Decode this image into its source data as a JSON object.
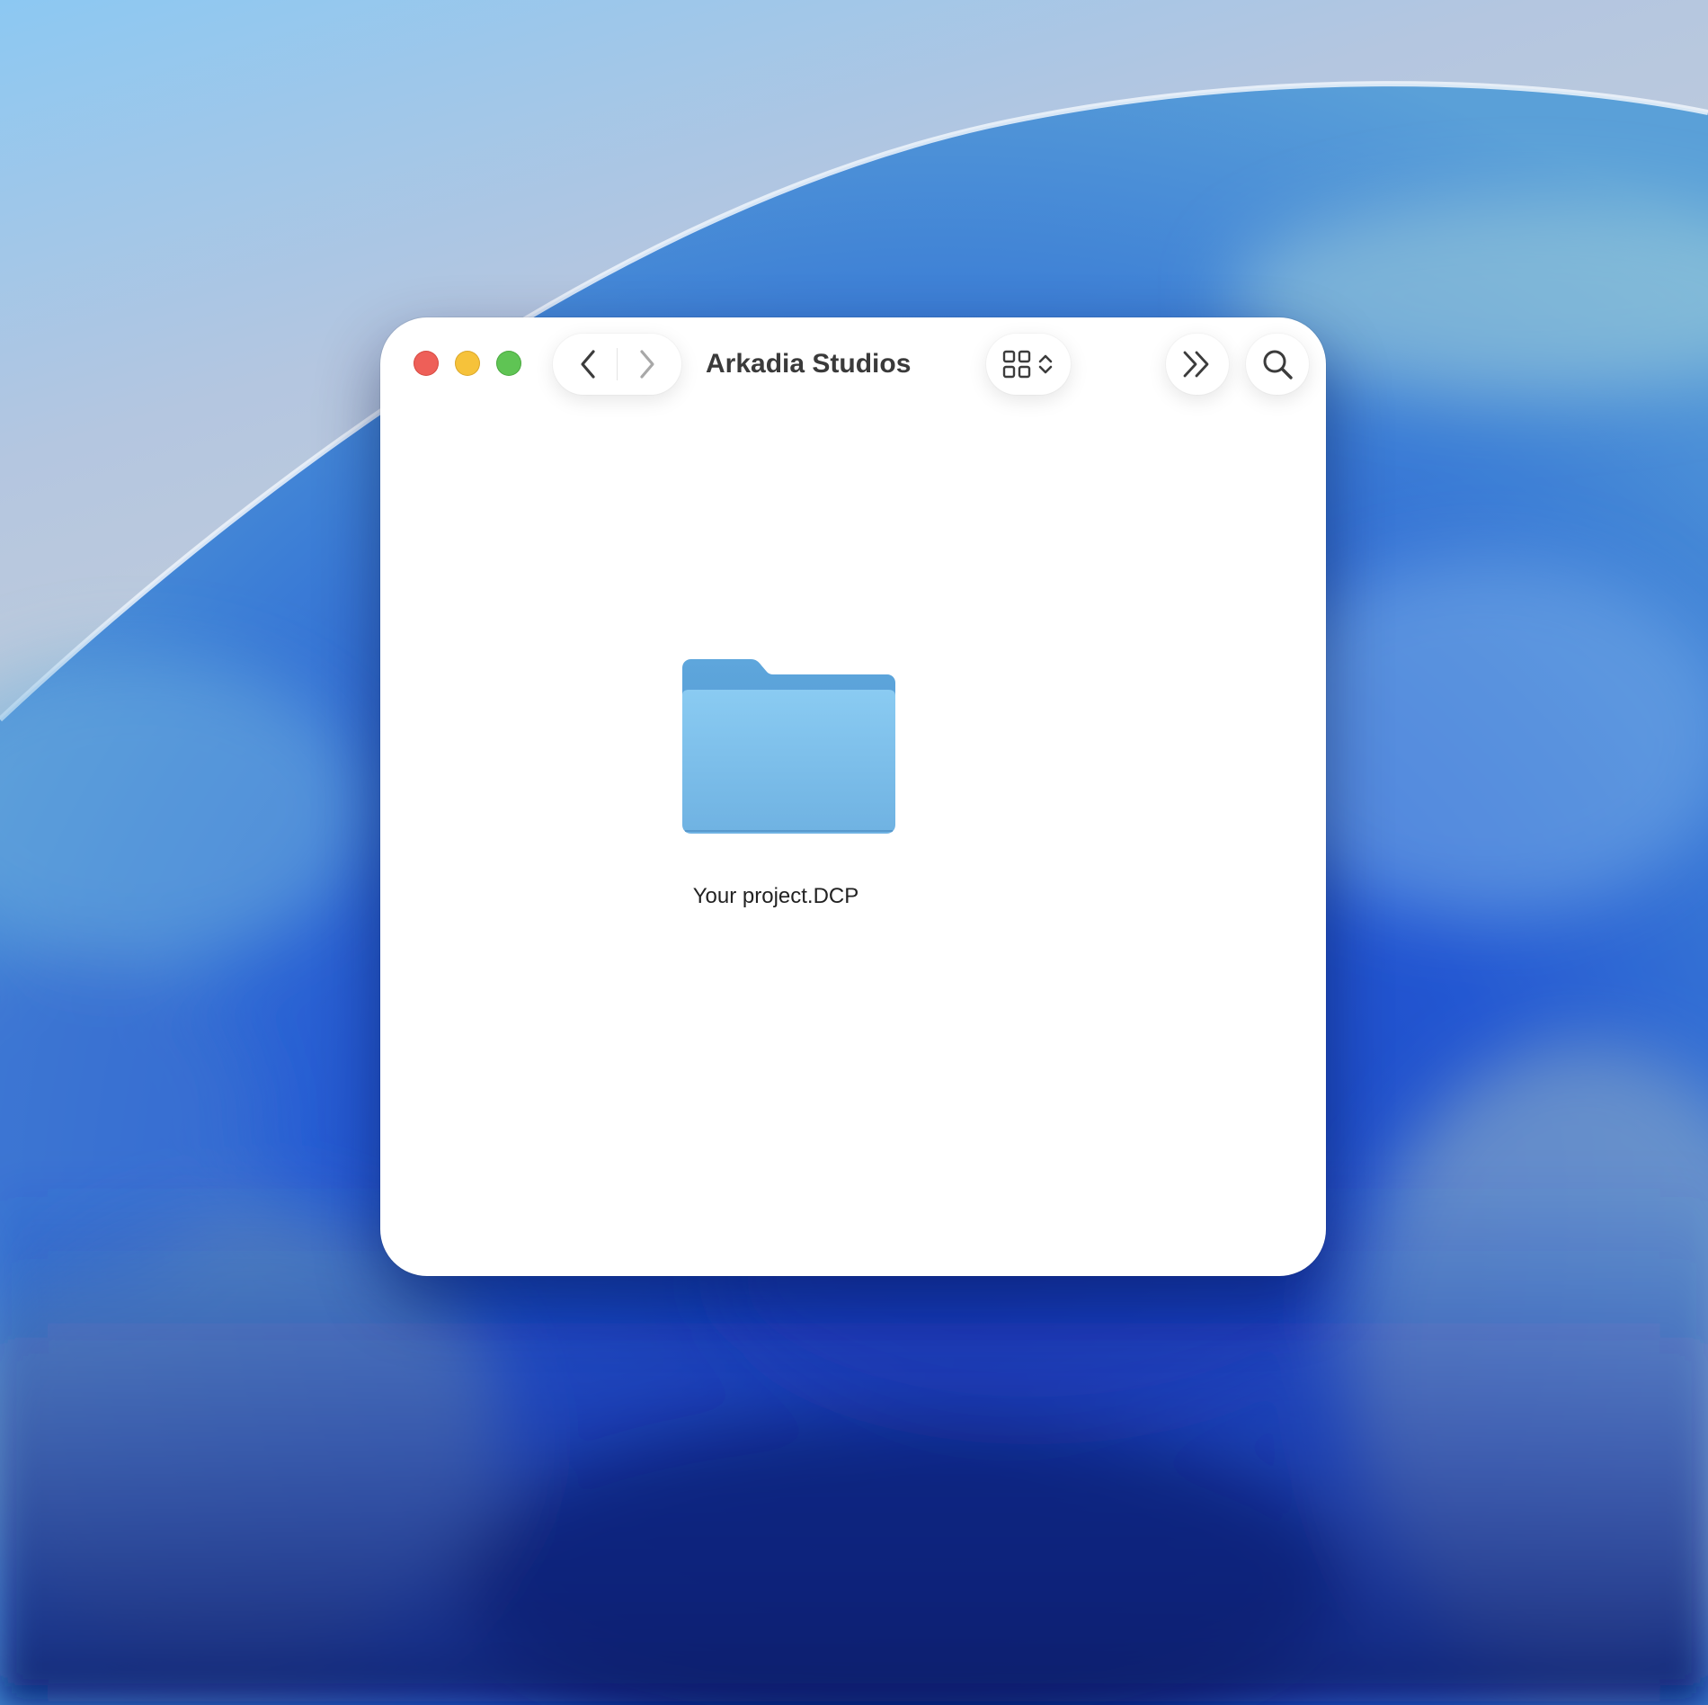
{
  "window": {
    "title": "Arkadia Studios"
  },
  "toolbar": {
    "back_icon": "chevron-left-icon",
    "forward_icon": "chevron-right-icon",
    "view_icon": "grid-view-icon",
    "view_menu_icon": "up-down-chevron-icon",
    "more_icon": "double-chevron-right-icon",
    "search_icon": "magnifying-glass-icon"
  },
  "traffic_lights": {
    "close_color": "#ee5f58",
    "minimize_color": "#f6c23a",
    "zoom_color": "#5fc454"
  },
  "content": {
    "items": [
      {
        "name": "Your project.DCP",
        "icon": "folder-icon",
        "color": "#6cb6e8"
      }
    ]
  }
}
